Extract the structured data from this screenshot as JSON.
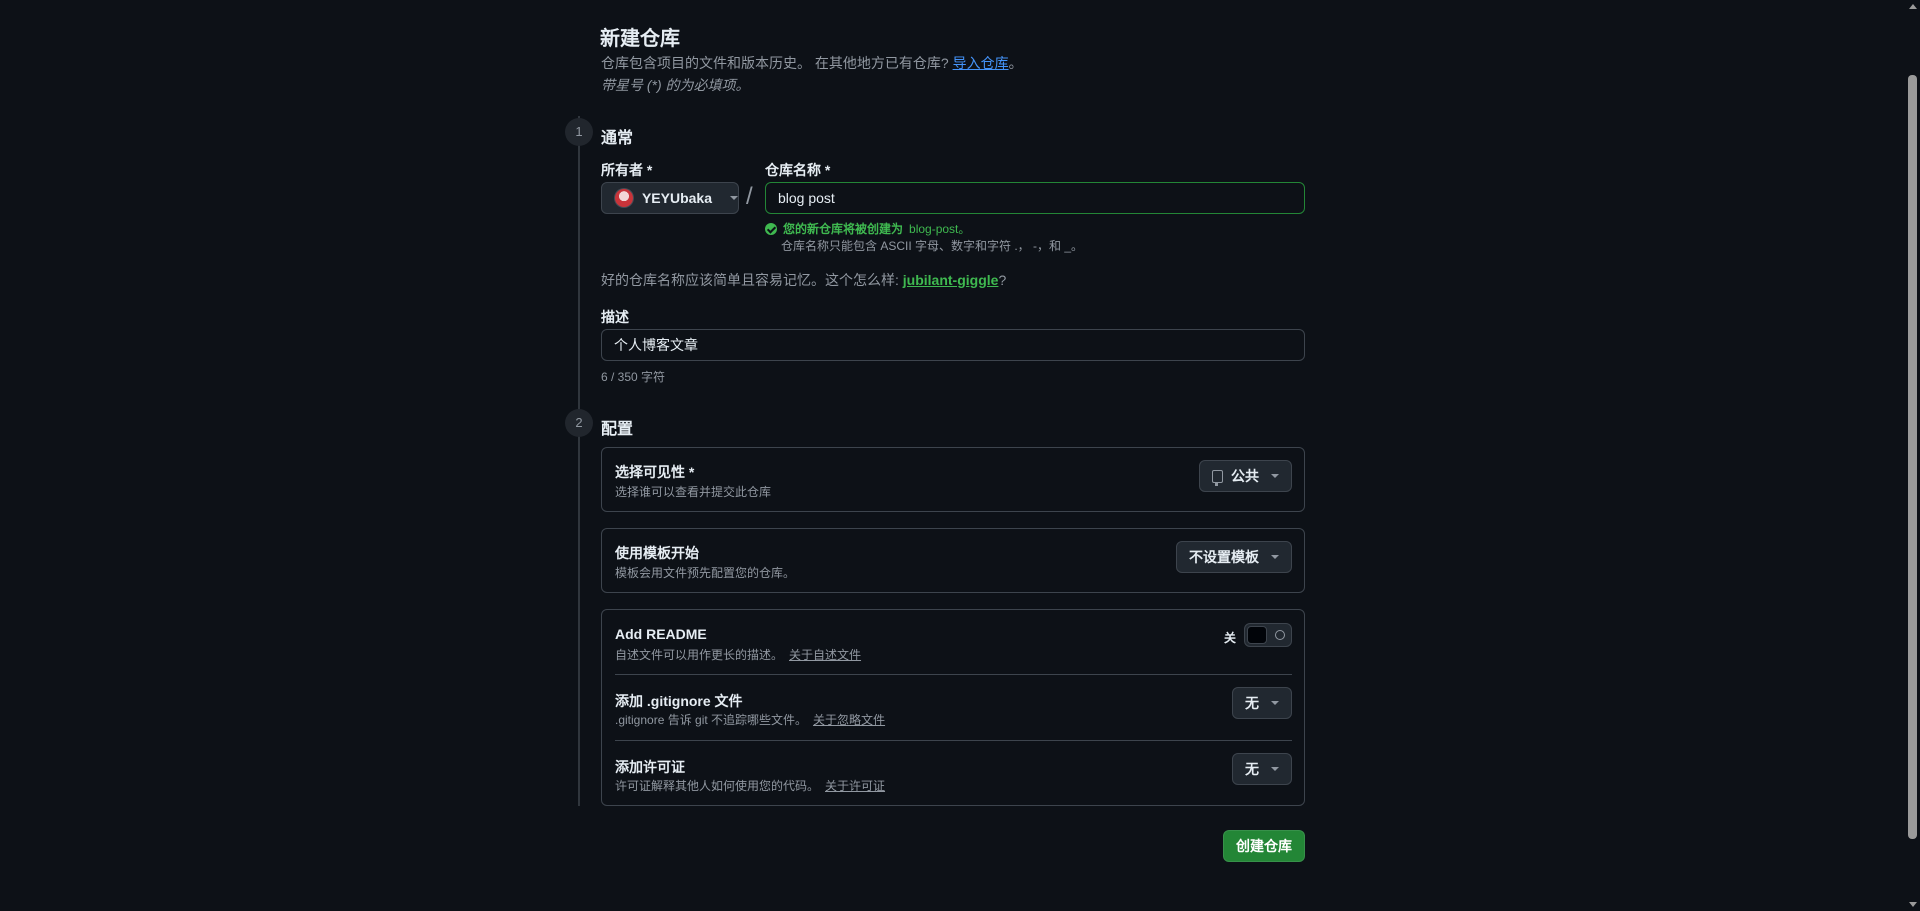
{
  "header": {
    "title": "新建仓库",
    "subtitle": "仓库包含项目的文件和版本历史。 在其他地方已有仓库?",
    "import_link": "导入仓库",
    "subtitle_end": "。",
    "required_note": "带星号 (*) 的为必填项。"
  },
  "step1": {
    "number": "1",
    "title": "通常",
    "owner_label": "所有者 *",
    "owner_value": "YEYUbaka",
    "slash": "/",
    "name_label": "仓库名称 *",
    "name_value": "blog post",
    "valid_prefix": "您的新仓库将被创建为",
    "valid_name": "blog-post。",
    "name_hint": "仓库名称只能包含 ASCII 字母、数字和字符 .， -，和 _。",
    "suggest_text": "好的仓库名称应该简单且容易记忆。这个怎么样:",
    "suggest_name": "jubilant-giggle",
    "suggest_end": "?",
    "desc_label": "描述",
    "desc_value": "个人博客文章",
    "desc_count": "6 / 350 字符"
  },
  "step2": {
    "number": "2",
    "title": "配置",
    "visibility": {
      "title": "选择可见性 *",
      "desc": "选择谁可以查看并提交此仓库",
      "value": "公共"
    },
    "template": {
      "title": "使用模板开始",
      "desc": "模板会用文件预先配置您的仓库。",
      "value": "不设置模板"
    },
    "readme": {
      "title": "Add README",
      "desc": "自述文件可以用作更长的描述。",
      "link": "关于自述文件",
      "toggle_label": "关"
    },
    "gitignore": {
      "title": "添加 .gitignore 文件",
      "desc": ".gitignore 告诉 git 不追踪哪些文件。",
      "link": "关于忽略文件",
      "value": "无"
    },
    "license": {
      "title": "添加许可证",
      "desc": "许可证解释其他人如何使用您的代码。",
      "link": "关于许可证",
      "value": "无"
    }
  },
  "actions": {
    "create_label": "创建仓库"
  },
  "colors": {
    "background": "#0d1117",
    "accent_green": "#238636",
    "link_blue": "#4493f8",
    "success_green": "#3fb950"
  }
}
